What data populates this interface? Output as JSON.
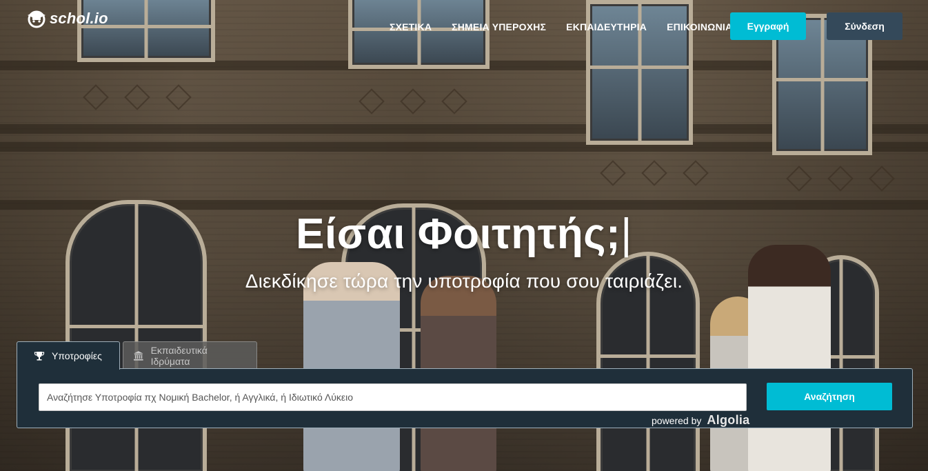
{
  "brand": {
    "name": "schol.io",
    "logo_icon": "graduation-cap-logo-icon"
  },
  "nav": {
    "items": [
      {
        "label": "ΣΧΕΤΙΚΑ"
      },
      {
        "label": "ΣΗΜΕΙΑ ΥΠΕΡΟΧΗΣ"
      },
      {
        "label": "ΕΚΠΑΙΔΕΥΤΗΡΙΑ"
      },
      {
        "label": "ΕΠΙΚΟΙΝΩΝΙΑ"
      }
    ],
    "register_label": "Εγγραφή",
    "login_label": "Σύνδεση"
  },
  "hero": {
    "title": "Είσαι Φοιτητής;",
    "cursor": "|",
    "subtitle": "Διεκδίκησε τώρα την υποτροφία που σου ταιριάζει."
  },
  "search": {
    "tabs": [
      {
        "label": "Υποτροφίες",
        "icon": "trophy-icon",
        "active": true
      },
      {
        "label": "Εκπαιδευτικά Ιδρύματα",
        "icon": "institution-icon",
        "active": false
      }
    ],
    "placeholder": "Αναζήτησε Υποτροφία πχ Νομική Bachelor, ή Αγγλικά, ή Ιδιωτικό Λύκειο",
    "value": "",
    "button_label": "Αναζήτηση",
    "powered_by_label": "powered by",
    "powered_by_brand": "Algolia"
  },
  "colors": {
    "accent": "#00bcd4",
    "dark_button": "#34495a",
    "panel_bg": "#1f2f3a"
  }
}
